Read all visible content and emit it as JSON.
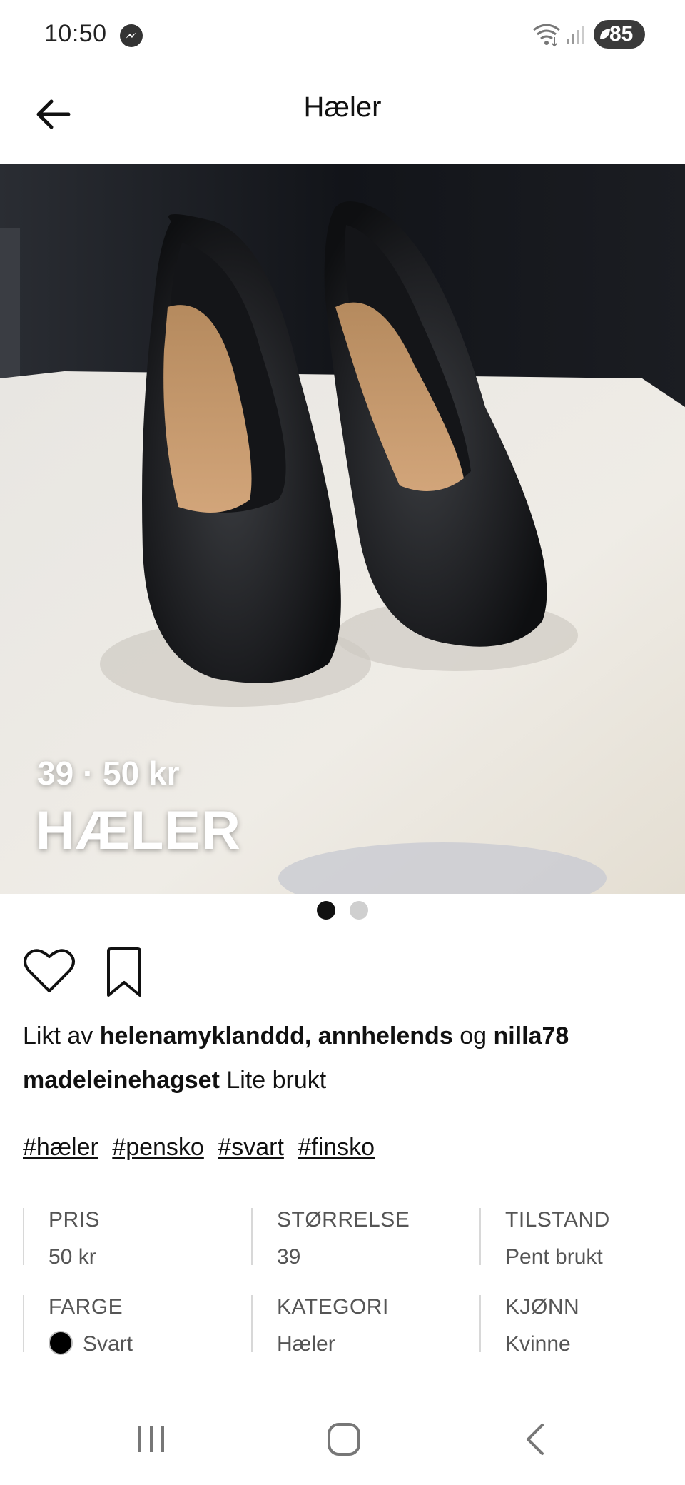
{
  "status_bar": {
    "time": "10:50",
    "battery": "85",
    "icons": [
      "messenger-icon",
      "wifi-icon",
      "signal-icon",
      "battery-icon"
    ]
  },
  "header": {
    "title": "Hæler",
    "back_icon": "arrow-left-icon"
  },
  "listing": {
    "overlay_meta": "39 · 50 kr",
    "overlay_title": "HÆLER",
    "image_count": 2,
    "active_image": 1
  },
  "social": {
    "liked_prefix": "Likt av",
    "liked_users": "helenamyklanddd, annhelends",
    "liked_connector": "og",
    "liked_last": "nilla78",
    "seller": "madeleinehagset",
    "description": "Lite brukt"
  },
  "tags": [
    "#hæler",
    "#pensko",
    "#svart",
    "#finsko"
  ],
  "details": [
    {
      "label": "PRIS",
      "value": "50 kr"
    },
    {
      "label": "STØRRELSE",
      "value": "39"
    },
    {
      "label": "TILSTAND",
      "value": "Pent brukt"
    },
    {
      "label": "FARGE",
      "value": "Svart",
      "swatch": "#000000"
    },
    {
      "label": "KATEGORI",
      "value": "Hæler"
    },
    {
      "label": "KJØNN",
      "value": "Kvinne"
    }
  ],
  "nav_bar": {
    "icons": [
      "recent-apps-icon",
      "home-icon",
      "back-icon"
    ]
  }
}
